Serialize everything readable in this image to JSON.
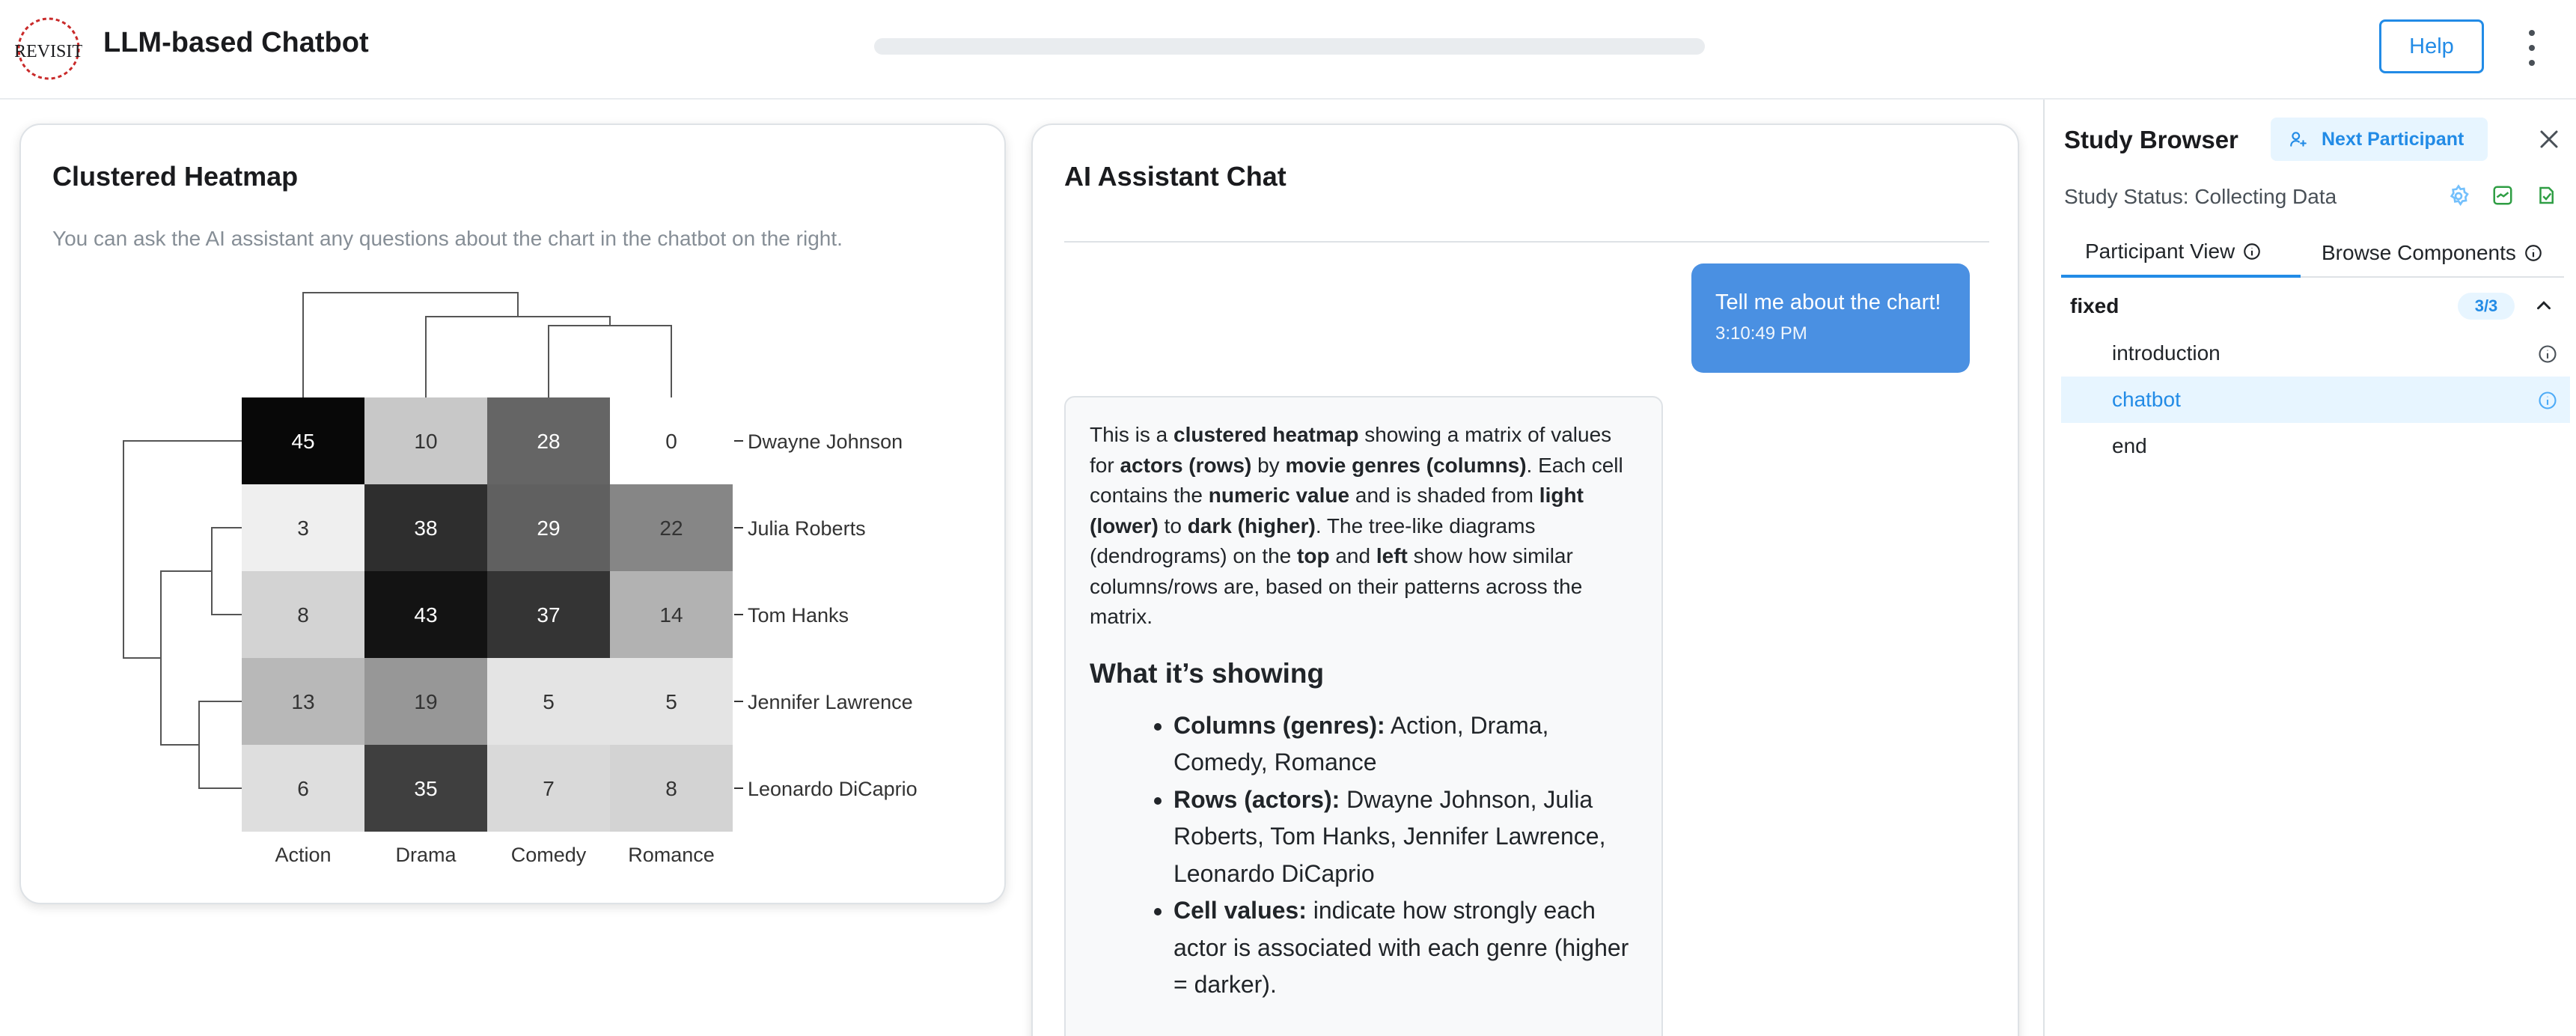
{
  "header": {
    "logo_text": "REVISIT",
    "title": "LLM-based Chatbot",
    "progress": 0,
    "help_label": "Help"
  },
  "heatmap_card": {
    "title": "Clustered Heatmap",
    "description": "You can ask the AI assistant any questions about the chart in the chatbot on the right."
  },
  "chart_data": {
    "type": "heatmap",
    "title": "",
    "columns": [
      "Action",
      "Drama",
      "Comedy",
      "Romance"
    ],
    "rows": [
      "Dwayne Johnson",
      "Julia Roberts",
      "Tom Hanks",
      "Jennifer Lawrence",
      "Leonardo DiCaprio"
    ],
    "values": [
      [
        45,
        10,
        28,
        0
      ],
      [
        3,
        38,
        29,
        22
      ],
      [
        8,
        43,
        37,
        14
      ],
      [
        13,
        19,
        5,
        5
      ],
      [
        6,
        35,
        7,
        8
      ]
    ],
    "color_scale": "grayscale light (low) to dark (high)",
    "dendrograms": [
      "top (columns)",
      "left (rows)"
    ]
  },
  "chat_card": {
    "title": "AI Assistant Chat",
    "user_message": "Tell me about the chart!",
    "user_time": "3:10:49 PM",
    "ai_intro": [
      {
        "t": "This is a "
      },
      {
        "b": "clustered heatmap"
      },
      {
        "t": " showing a matrix of values for "
      },
      {
        "b": "actors (rows)"
      },
      {
        "t": " by "
      },
      {
        "b": "movie genres (columns)"
      },
      {
        "t": ". Each cell contains the "
      },
      {
        "b": "numeric value"
      },
      {
        "t": " and is shaded from "
      },
      {
        "b": "light (lower)"
      },
      {
        "t": " to "
      },
      {
        "b": "dark (higher)"
      },
      {
        "t": ". The tree-like diagrams (dendrograms) on the "
      },
      {
        "b": "top"
      },
      {
        "t": " and "
      },
      {
        "b": "left"
      },
      {
        "t": " show how similar columns/rows are, based on their patterns across the matrix."
      }
    ],
    "ai_heading": "What it’s showing",
    "ai_bullets": [
      {
        "label": "Columns (genres):",
        "text": " Action, Drama, Comedy, Romance"
      },
      {
        "label": "Rows (actors):",
        "text": " Dwayne Johnson, Julia Roberts, Tom Hanks, Jennifer Lawrence, Leonardo DiCaprio"
      },
      {
        "label": "Cell values:",
        "text": " indicate how strongly each actor is associated with each genre (higher = darker)."
      }
    ]
  },
  "study_browser": {
    "title": "Study Browser",
    "next_participant_label": "Next Participant",
    "status_label": "Study Status: Collecting Data",
    "tabs": [
      "Participant View",
      "Browse Components"
    ],
    "sequence_name": "fixed",
    "sequence_count": "3/3",
    "components": [
      "introduction",
      "chatbot",
      "end"
    ],
    "active_component": "chatbot"
  },
  "colors": {
    "accent": "#228be6",
    "user_bubble": "#4a90e2",
    "logo_red": "#c92a2a"
  }
}
